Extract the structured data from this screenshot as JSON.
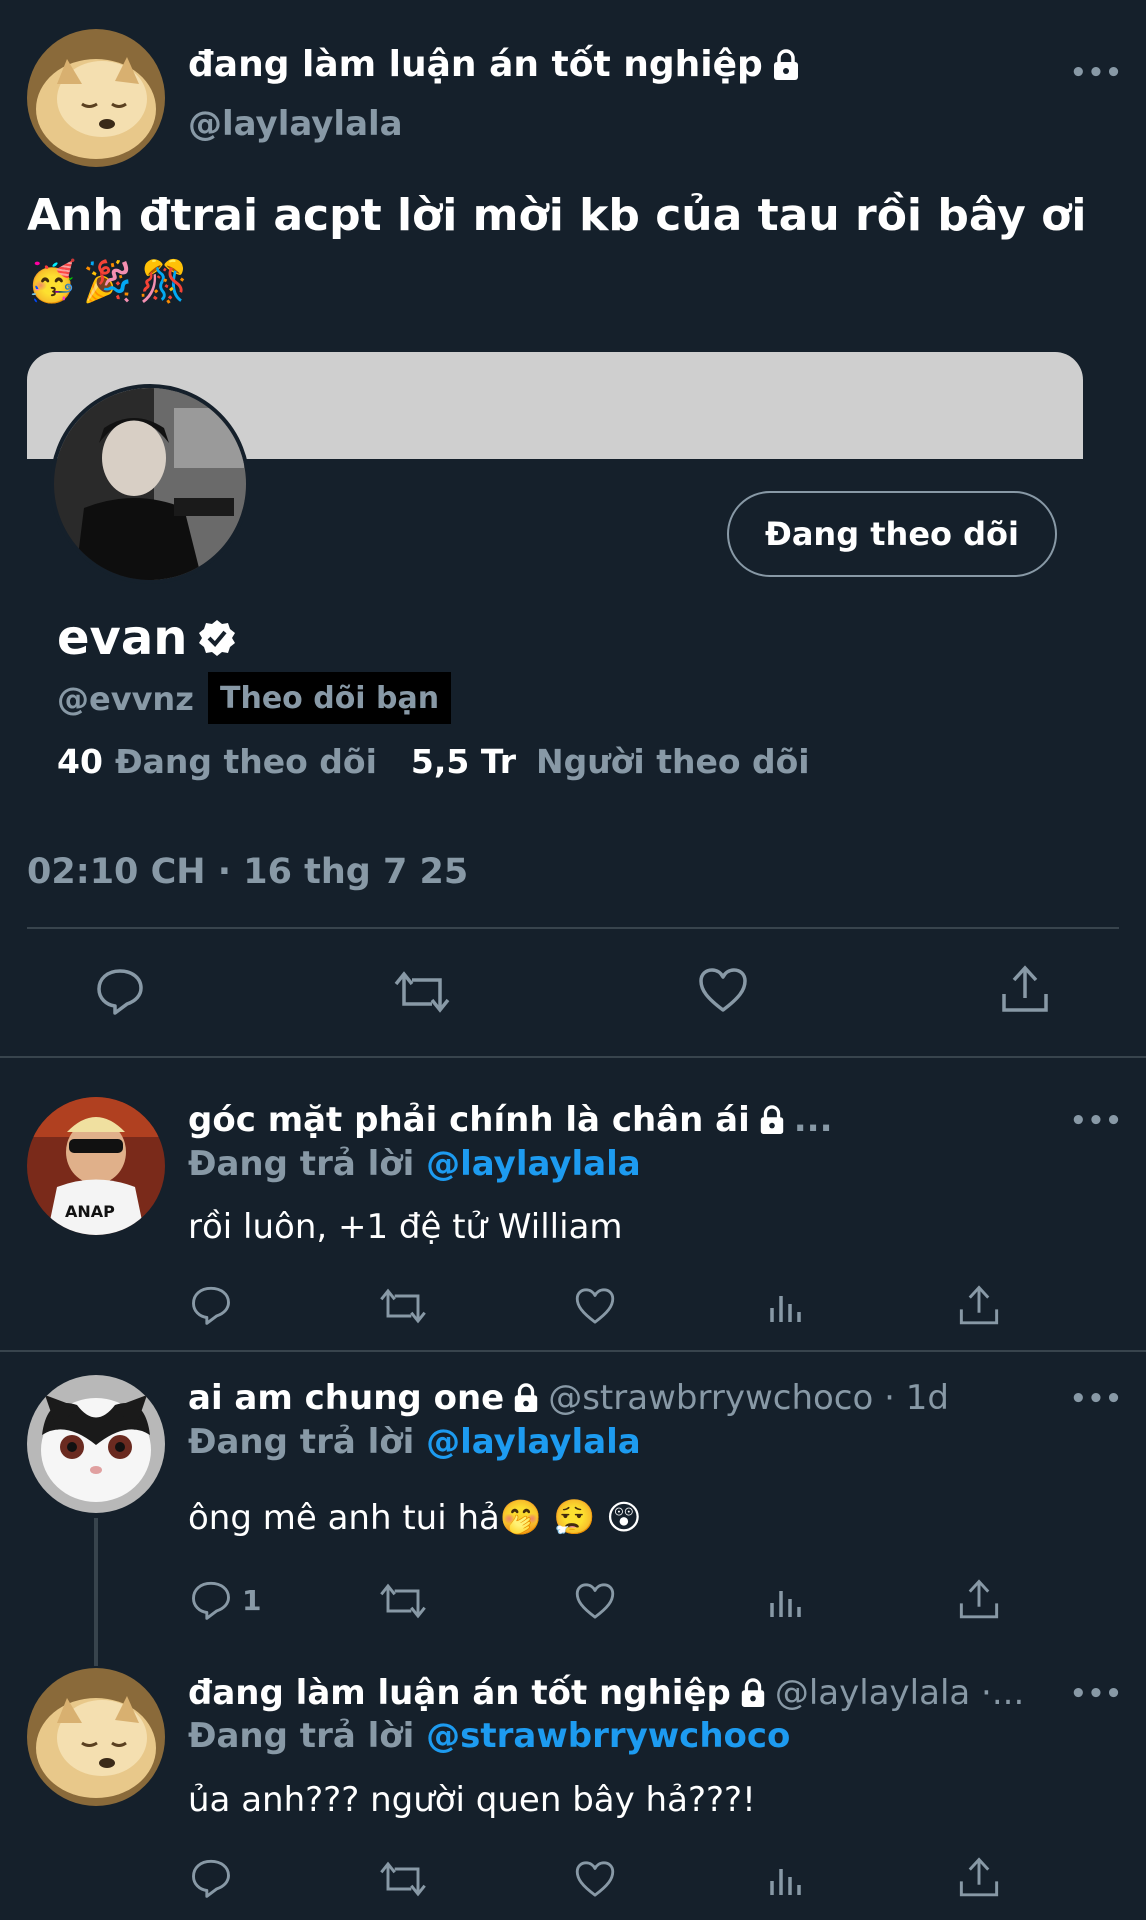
{
  "main_tweet": {
    "display_name": "đang làm luận án tốt nghiệp",
    "handle": "@laylaylala",
    "text": "Anh đtrai acpt lời mời kb của tau rồi bây ơi",
    "emojis": "🥳🎉🎊",
    "timestamp": "02:10 CH · 16 thg 7 25",
    "more": "•••"
  },
  "profile_card": {
    "name": "evan",
    "handle": "@evvnz",
    "follows_you": "Theo dõi bạn",
    "follow_button": "Đang theo dõi",
    "following_count": "40",
    "following_label": "Đang theo dõi",
    "followers_count": "5,5 Tr",
    "followers_label": "Người theo dõi"
  },
  "replies": [
    {
      "display_name": "góc mặt phải chính là chân ái",
      "trail": "...",
      "replying_prefix": "Đang trả lời",
      "replying_to": "@laylaylala",
      "text": "rồi luôn, +1 đệ tử William",
      "reply_count": ""
    },
    {
      "display_name": "ai am chung one",
      "handle_time": "@strawbrrywchoco · 1d",
      "replying_prefix": "Đang trả lời",
      "replying_to": "@laylaylala",
      "text": "ông mê anh tui hả🤭 😮‍💨 😲",
      "reply_count": "1"
    },
    {
      "display_name": "đang làm luận án tốt nghiệp",
      "handle_time": "@laylaylala ·...",
      "replying_prefix": "Đang trả lời",
      "replying_to": "@strawbrrywchoco",
      "text": "ủa anh??? người quen bây hả???!",
      "reply_count": ""
    }
  ],
  "colors": {
    "background": "#15202b",
    "muted": "#8899a6",
    "link": "#1d9bf0",
    "divider": "#38444d",
    "banner": "#cfcfcf"
  },
  "icons": [
    "lock-icon",
    "verified-badge-icon",
    "reply-icon",
    "retweet-icon",
    "like-icon",
    "share-icon",
    "views-icon",
    "more-icon"
  ]
}
